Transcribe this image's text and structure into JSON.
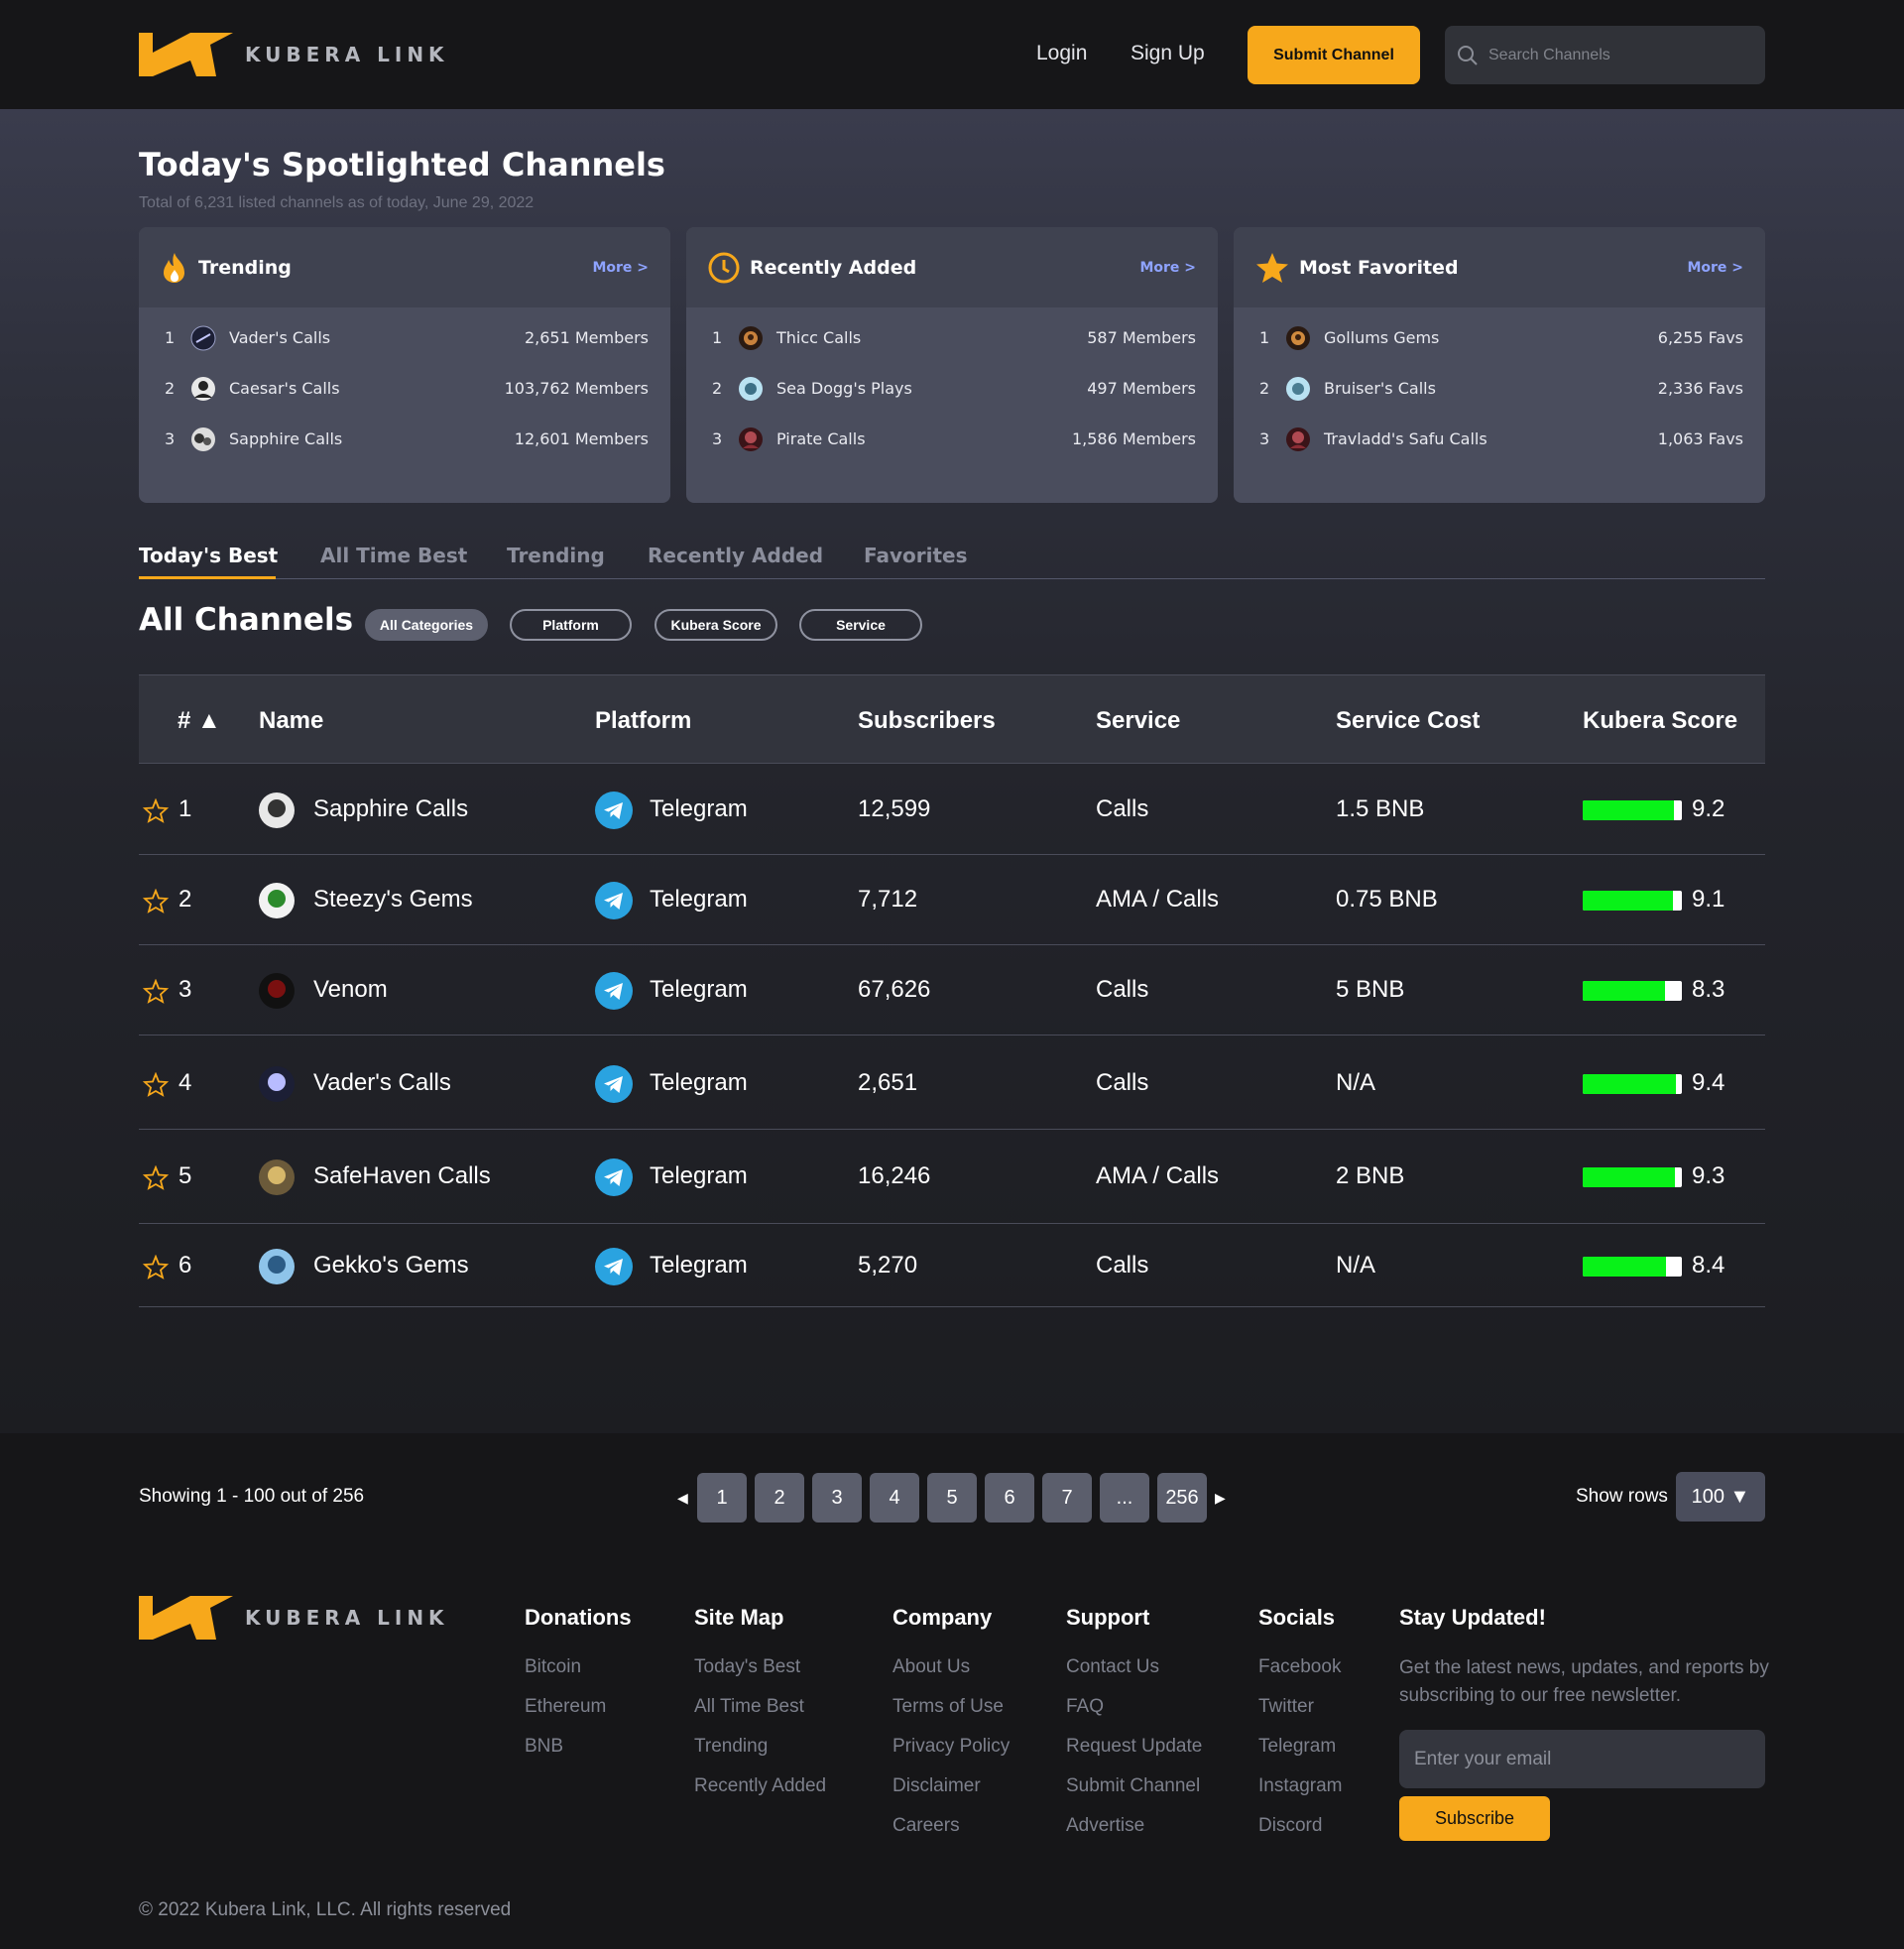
{
  "header": {
    "brand": "KUBERA LINK",
    "login": "Login",
    "signup": "Sign Up",
    "submit_channel": "Submit Channel",
    "search_placeholder": "Search Channels"
  },
  "spotlight": {
    "title": "Today's Spotlighted Channels",
    "subtitle": "Total of 6,231 listed channels as of today, June 29, 2022",
    "cards": [
      {
        "title": "Trending",
        "icon": "fire-icon",
        "more": "More >",
        "items": [
          {
            "rank": "1",
            "name": "Vader's Calls",
            "count": "2,651 Members"
          },
          {
            "rank": "2",
            "name": "Caesar's Calls",
            "count": "103,762 Members"
          },
          {
            "rank": "3",
            "name": "Sapphire Calls",
            "count": "12,601 Members"
          }
        ]
      },
      {
        "title": "Recently Added",
        "icon": "clock-icon",
        "more": "More >",
        "items": [
          {
            "rank": "1",
            "name": "Thicc Calls",
            "count": "587 Members"
          },
          {
            "rank": "2",
            "name": "Sea Dogg's Plays",
            "count": "497 Members"
          },
          {
            "rank": "3",
            "name": "Pirate Calls",
            "count": "1,586 Members"
          }
        ]
      },
      {
        "title": "Most Favorited",
        "icon": "star-icon",
        "more": "More >",
        "items": [
          {
            "rank": "1",
            "name": "Gollums Gems",
            "count": "6,255 Favs"
          },
          {
            "rank": "2",
            "name": "Bruiser's Calls",
            "count": "2,336 Favs"
          },
          {
            "rank": "3",
            "name": "Travladd's Safu Calls",
            "count": "1,063 Favs"
          }
        ]
      }
    ]
  },
  "tabs": [
    "Today's Best",
    "All Time Best",
    "Trending",
    "Recently Added",
    "Favorites"
  ],
  "channels": {
    "title": "All Channels",
    "filters": [
      "All Categories",
      "Platform",
      "Kubera Score",
      "Service"
    ],
    "columns": [
      "# ▲",
      "Name",
      "Platform",
      "Subscribers",
      "Service",
      "Service Cost",
      "Kubera Score"
    ],
    "rows": [
      {
        "rank": "1",
        "name": "Sapphire Calls",
        "platform": "Telegram",
        "subscribers": "12,599",
        "service": "Calls",
        "cost": "1.5 BNB",
        "score": "9.2",
        "score_value": 0.92
      },
      {
        "rank": "2",
        "name": "Steezy's Gems",
        "platform": "Telegram",
        "subscribers": "7,712",
        "service": "AMA / Calls",
        "cost": "0.75 BNB",
        "score": "9.1",
        "score_value": 0.91
      },
      {
        "rank": "3",
        "name": "Venom",
        "platform": "Telegram",
        "subscribers": "67,626",
        "service": "Calls",
        "cost": "5 BNB",
        "score": "8.3",
        "score_value": 0.83
      },
      {
        "rank": "4",
        "name": "Vader's Calls",
        "platform": "Telegram",
        "subscribers": "2,651",
        "service": "Calls",
        "cost": "N/A",
        "score": "9.4",
        "score_value": 0.94
      },
      {
        "rank": "5",
        "name": "SafeHaven Calls",
        "platform": "Telegram",
        "subscribers": "16,246",
        "service": "AMA / Calls",
        "cost": "2 BNB",
        "score": "9.3",
        "score_value": 0.93
      },
      {
        "rank": "6",
        "name": "Gekko's Gems",
        "platform": "Telegram",
        "subscribers": "5,270",
        "service": "Calls",
        "cost": "N/A",
        "score": "8.4",
        "score_value": 0.84
      }
    ]
  },
  "pagination": {
    "showing": "Showing 1 - 100 out of 256",
    "pages": [
      "1",
      "2",
      "3",
      "4",
      "5",
      "6",
      "7",
      "...",
      "256"
    ],
    "rows_label": "Show rows",
    "rows_value": "100 ▼"
  },
  "footer": {
    "brand": "KUBERA LINK",
    "columns": [
      {
        "title": "Donations",
        "links": [
          "Bitcoin",
          "Ethereum",
          "BNB"
        ]
      },
      {
        "title": "Site Map",
        "links": [
          "Today's Best",
          "All Time Best",
          "Trending",
          "Recently Added"
        ]
      },
      {
        "title": "Company",
        "links": [
          "About Us",
          "Terms of Use",
          "Privacy Policy",
          "Disclaimer",
          "Careers"
        ]
      },
      {
        "title": "Support",
        "links": [
          "Contact Us",
          "FAQ",
          "Request Update",
          "Submit Channel",
          "Advertise"
        ]
      },
      {
        "title": "Socials",
        "links": [
          "Facebook",
          "Twitter",
          "Telegram",
          "Instagram",
          "Discord"
        ]
      }
    ],
    "newsletter_title": "Stay Updated!",
    "newsletter_text": "Get the latest news, updates, and reports by subscribing to our free newsletter.",
    "email_placeholder": "Enter your email",
    "subscribe": "Subscribe",
    "copyright": "© 2022 Kubera Link, LLC. All rights reserved"
  },
  "colors": {
    "accent": "#f7a81b",
    "score": "#08f218",
    "more_link": "#8ea3ff",
    "telegram": "#2aa3e0"
  }
}
